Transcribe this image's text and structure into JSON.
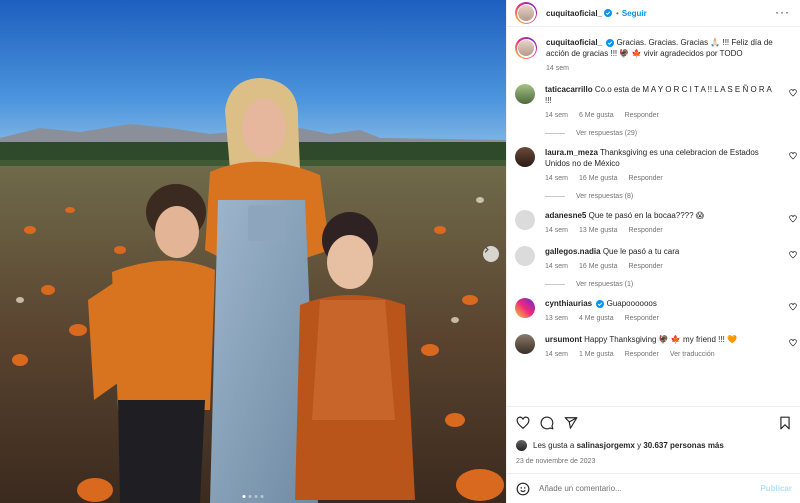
{
  "post": {
    "username": "cuquitaoficial_",
    "separator": "•",
    "follow_label": "Seguir",
    "caption_text": "Gracias. Gracias. Gracias 🙏🏻 !!! Feliz día de acción de gracias !!! 🦃 🍁 vivir agradecidos por TODO",
    "caption_time": "14 sem"
  },
  "comments": [
    {
      "user": "taticacarrillo",
      "text": "Co.o esta de M A Y O R C I T A !! L A S E Ñ O R A !!!",
      "time": "14 sem",
      "likes": "6 Me gusta",
      "reply": "Responder",
      "replies": "Ver respuestas (29)"
    },
    {
      "user": "laura.m_meza",
      "text": "Thanksgiving es una celebracion de Estados Unidos no de México",
      "time": "14 sem",
      "likes": "16 Me gusta",
      "reply": "Responder",
      "replies": "Ver respuestas (8)"
    },
    {
      "user": "adanesne5",
      "text": "Que te pasó en la bocaa???? 😱",
      "time": "14 sem",
      "likes": "13 Me gusta",
      "reply": "Responder"
    },
    {
      "user": "gallegos.nadia",
      "text": "Que le pasó a tu cara",
      "time": "14 sem",
      "likes": "16 Me gusta",
      "reply": "Responder",
      "replies": "Ver respuestas (1)"
    },
    {
      "user": "cynthiaurias",
      "text": "Guapoooooos",
      "time": "13 sem",
      "likes": "4 Me gusta",
      "reply": "Responder"
    },
    {
      "user": "ursumont",
      "text": "Happy Thanksgiving 🦃 🍁 my friend !!! 🧡",
      "time": "14 sem",
      "likes": "1 Me gusta",
      "reply": "Responder",
      "translate": "Ver traducción"
    }
  ],
  "likes": {
    "prefix": "Les gusta a",
    "user": "salinasjorgemx",
    "middle": "y",
    "count": "30.637 personas más"
  },
  "date": "23 de noviembre de 2023",
  "comment_box": {
    "placeholder": "Añade un comentario...",
    "publish_label": "Publicar"
  },
  "icons": {
    "more": "more-options-icon",
    "like": "heart-icon",
    "comment": "comment-icon",
    "share": "share-icon",
    "save": "bookmark-icon",
    "emoji": "emoji-icon",
    "verified": "verified-badge-icon",
    "next": "chevron-right-icon"
  },
  "colors": {
    "accent": "#0095f6",
    "verified": "#0095f6",
    "muted": "#737373",
    "publish_disabled": "#b2dffc"
  },
  "carousel": {
    "total": 4,
    "active": 0
  }
}
